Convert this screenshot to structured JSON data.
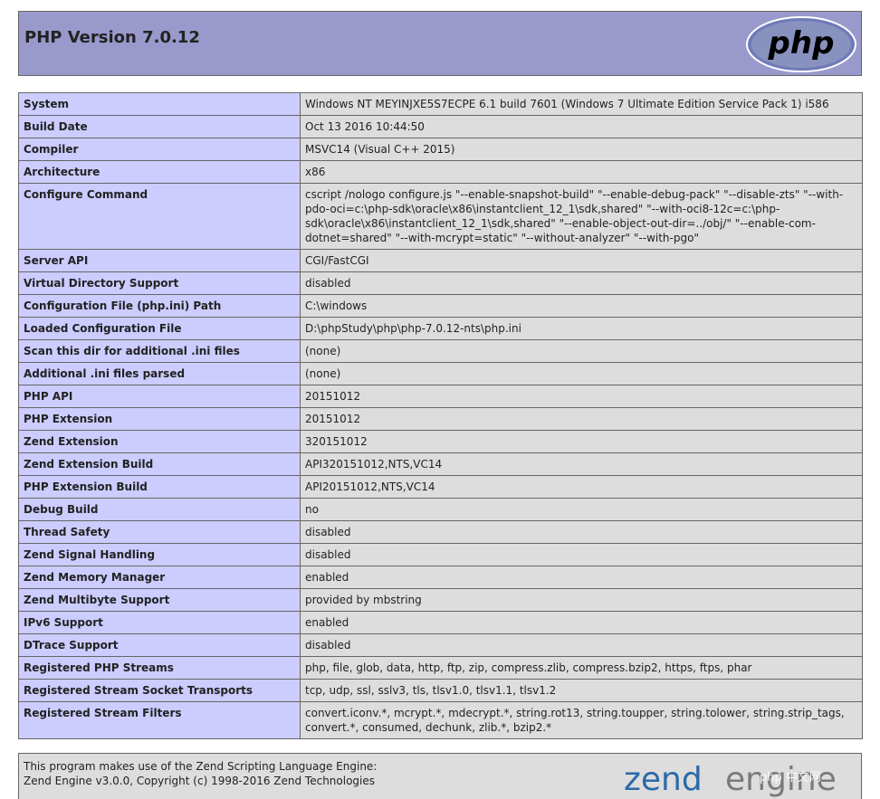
{
  "header": {
    "title": "PHP Version 7.0.12",
    "logo_text": "php"
  },
  "rows": [
    {
      "label": "System",
      "value": "Windows NT MEYINJXE5S7ECPE 6.1 build 7601 (Windows 7 Ultimate Edition Service Pack 1) i586"
    },
    {
      "label": "Build Date",
      "value": "Oct 13 2016 10:44:50"
    },
    {
      "label": "Compiler",
      "value": "MSVC14 (Visual C++ 2015)"
    },
    {
      "label": "Architecture",
      "value": "x86"
    },
    {
      "label": "Configure Command",
      "value": "cscript /nologo configure.js \"--enable-snapshot-build\" \"--enable-debug-pack\" \"--disable-zts\" \"--with-pdo-oci=c:\\php-sdk\\oracle\\x86\\instantclient_12_1\\sdk,shared\" \"--with-oci8-12c=c:\\php-sdk\\oracle\\x86\\instantclient_12_1\\sdk,shared\" \"--enable-object-out-dir=../obj/\" \"--enable-com-dotnet=shared\" \"--with-mcrypt=static\" \"--without-analyzer\" \"--with-pgo\""
    },
    {
      "label": "Server API",
      "value": "CGI/FastCGI"
    },
    {
      "label": "Virtual Directory Support",
      "value": "disabled"
    },
    {
      "label": "Configuration File (php.ini) Path",
      "value": "C:\\windows"
    },
    {
      "label": "Loaded Configuration File",
      "value": "D:\\phpStudy\\php\\php-7.0.12-nts\\php.ini"
    },
    {
      "label": "Scan this dir for additional .ini files",
      "value": "(none)"
    },
    {
      "label": "Additional .ini files parsed",
      "value": "(none)"
    },
    {
      "label": "PHP API",
      "value": "20151012"
    },
    {
      "label": "PHP Extension",
      "value": "20151012"
    },
    {
      "label": "Zend Extension",
      "value": "320151012"
    },
    {
      "label": "Zend Extension Build",
      "value": "API320151012,NTS,VC14"
    },
    {
      "label": "PHP Extension Build",
      "value": "API20151012,NTS,VC14"
    },
    {
      "label": "Debug Build",
      "value": "no"
    },
    {
      "label": "Thread Safety",
      "value": "disabled"
    },
    {
      "label": "Zend Signal Handling",
      "value": "disabled"
    },
    {
      "label": "Zend Memory Manager",
      "value": "enabled"
    },
    {
      "label": "Zend Multibyte Support",
      "value": "provided by mbstring"
    },
    {
      "label": "IPv6 Support",
      "value": "enabled"
    },
    {
      "label": "DTrace Support",
      "value": "disabled"
    },
    {
      "label": "Registered PHP Streams",
      "value": "php, file, glob, data, http, ftp, zip, compress.zlib, compress.bzip2, https, ftps, phar"
    },
    {
      "label": "Registered Stream Socket Transports",
      "value": "tcp, udp, ssl, sslv3, tls, tlsv1.0, tlsv1.1, tlsv1.2"
    },
    {
      "label": "Registered Stream Filters",
      "value": "convert.iconv.*, mcrypt.*, mdecrypt.*, string.rot13, string.toupper, string.tolower, string.strip_tags, convert.*, consumed, dechunk, zlib.*, bzip2.*"
    }
  ],
  "footer": {
    "line1": "This program makes use of the Zend Scripting Language Engine:",
    "line2": "Zend Engine v3.0.0, Copyright (c) 1998-2016 Zend Technologies",
    "logo_zend": "zend",
    "logo_engine": "engine",
    "watermark": "php 中文网"
  },
  "colors": {
    "header_bg": "#9999cc",
    "label_bg": "#ccccff",
    "value_bg": "#dddddd",
    "logo_blue": "#2b6aa8"
  }
}
